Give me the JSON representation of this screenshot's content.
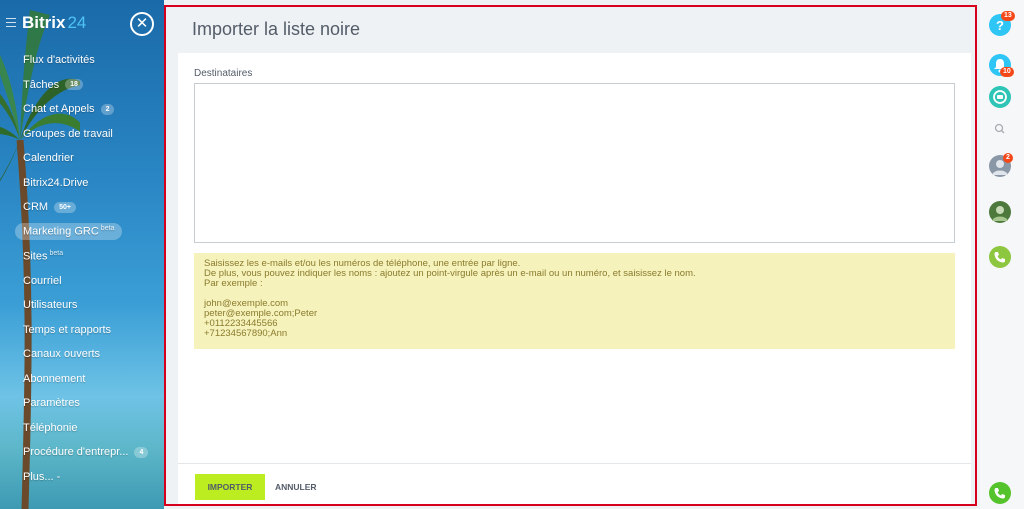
{
  "sidebar": {
    "brand_name": "Bitrix",
    "brand_number": "24",
    "close_symbol": "✕",
    "items": [
      {
        "label": "Flux d'activités",
        "counter": null,
        "sup": null
      },
      {
        "label": "Tâches",
        "counter": "18",
        "sup": null
      },
      {
        "label": "Chat et Appels",
        "counter": "2",
        "sup": null
      },
      {
        "label": "Groupes de travail",
        "counter": null,
        "sup": null
      },
      {
        "label": "Calendrier",
        "counter": null,
        "sup": null
      },
      {
        "label": "Bitrix24.Drive",
        "counter": null,
        "sup": null
      },
      {
        "label": "CRM",
        "counter": "50+",
        "sup": null
      },
      {
        "label": "Marketing GRC",
        "counter": null,
        "sup": "beta"
      },
      {
        "label": "Sites",
        "counter": null,
        "sup": "beta"
      },
      {
        "label": "Courriel",
        "counter": null,
        "sup": null
      },
      {
        "label": "Utilisateurs",
        "counter": null,
        "sup": null
      },
      {
        "label": "Temps et rapports",
        "counter": null,
        "sup": null
      },
      {
        "label": "Canaux ouverts",
        "counter": null,
        "sup": null
      },
      {
        "label": "Abonnement",
        "counter": null,
        "sup": null
      },
      {
        "label": "Paramètres",
        "counter": null,
        "sup": null
      },
      {
        "label": "Téléphonie",
        "counter": null,
        "sup": null
      },
      {
        "label": "Procédure d'entrepr...",
        "counter": "4",
        "sup": null
      },
      {
        "label": "Plus... -",
        "counter": null,
        "sup": null
      }
    ]
  },
  "panel": {
    "title": "Importer la liste noire",
    "recipients_label": "Destinataires",
    "recipients_value": "",
    "hint_lines": [
      "Saisissez les e-mails et/ou les numéros de téléphone, une entrée par ligne.",
      "De plus, vous pouvez indiquer les noms : ajoutez un point-virgule après un e-mail ou un numéro, et saisissez le nom.",
      "Par exemple :"
    ],
    "example_lines": [
      "john@exemple.com",
      "peter@exemple.com;Peter",
      "+0112233445566",
      "+71234567890;Ann"
    ],
    "import_button": "IMPORTER",
    "cancel_button": "ANNULER"
  },
  "rightbar": {
    "help_badge": "13",
    "notifications_badge": "10",
    "avatar_badge": "2"
  },
  "colors": {
    "accent_green": "#bbed21",
    "panel_border": "#d6001c",
    "hint_bg": "#f6f2bb",
    "badge_red": "#f54819"
  }
}
